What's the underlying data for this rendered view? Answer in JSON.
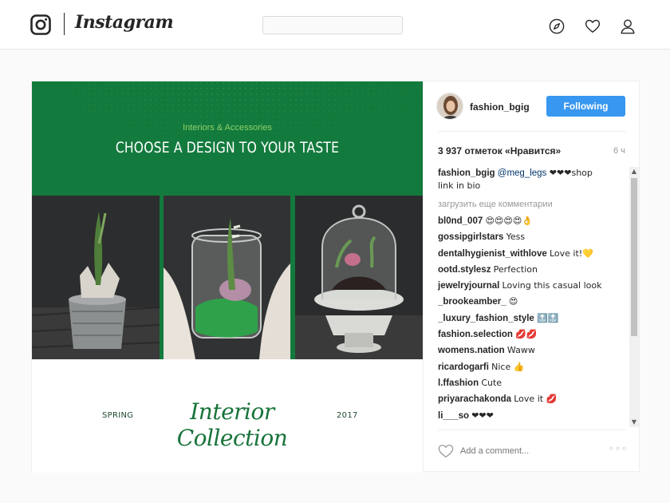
{
  "app": {
    "brand": "Instagram"
  },
  "search": {
    "placeholder": ""
  },
  "colors": {
    "accent": "#3897f0",
    "banner_green": "#137a3d",
    "script_green": "#18733a",
    "subtitle_green": "#8fd16b"
  },
  "icons": {
    "logo": "instagram-camera-icon",
    "explore": "compass-icon",
    "activity": "heart-icon",
    "profile": "person-icon"
  },
  "post": {
    "image_subtitle": "Interiors & Accessories",
    "image_title": "CHOOSE A DESIGN TO YOUR TASTE",
    "season_left": "SPRING",
    "collection_title": "Interior Collection",
    "season_right": "2017",
    "author": "fashion_bgig",
    "follow_label": "Following",
    "likes": "3 937 отметок «Нравится»",
    "time": "6 ч",
    "caption": {
      "user": "fashion_bgig",
      "mention": "@meg_legs",
      "text": " ❤❤❤shop link in bio"
    },
    "load_more": "загрузить еще комментарии",
    "comments": [
      {
        "user": "bl0nd_007",
        "text": "😍😍😍😍👌"
      },
      {
        "user": "gossipgirlstars",
        "text": "Yess"
      },
      {
        "user": "dentalhygienist_withlove",
        "text": "Love it!💛"
      },
      {
        "user": "ootd.stylesz",
        "text": "Perfection"
      },
      {
        "user": "jewelryjournal",
        "text": "Loving this casual look"
      },
      {
        "user": "_brookeamber_",
        "text": "😍"
      },
      {
        "user": "_luxury_fashion_style",
        "text": "🔝🔝"
      },
      {
        "user": "fashion.selection",
        "text": "💋💋"
      },
      {
        "user": "womens.nation",
        "text": "Waww"
      },
      {
        "user": "ricardogarfi",
        "text": "Nice 👍"
      },
      {
        "user": "l.ffashion",
        "text": "Cute"
      },
      {
        "user": "priyarachakonda",
        "text": "Love it 💋"
      },
      {
        "user": "li___so",
        "text": "❤❤❤"
      }
    ],
    "comment_placeholder": "Add a comment...",
    "more_label": "◦◦◦"
  }
}
